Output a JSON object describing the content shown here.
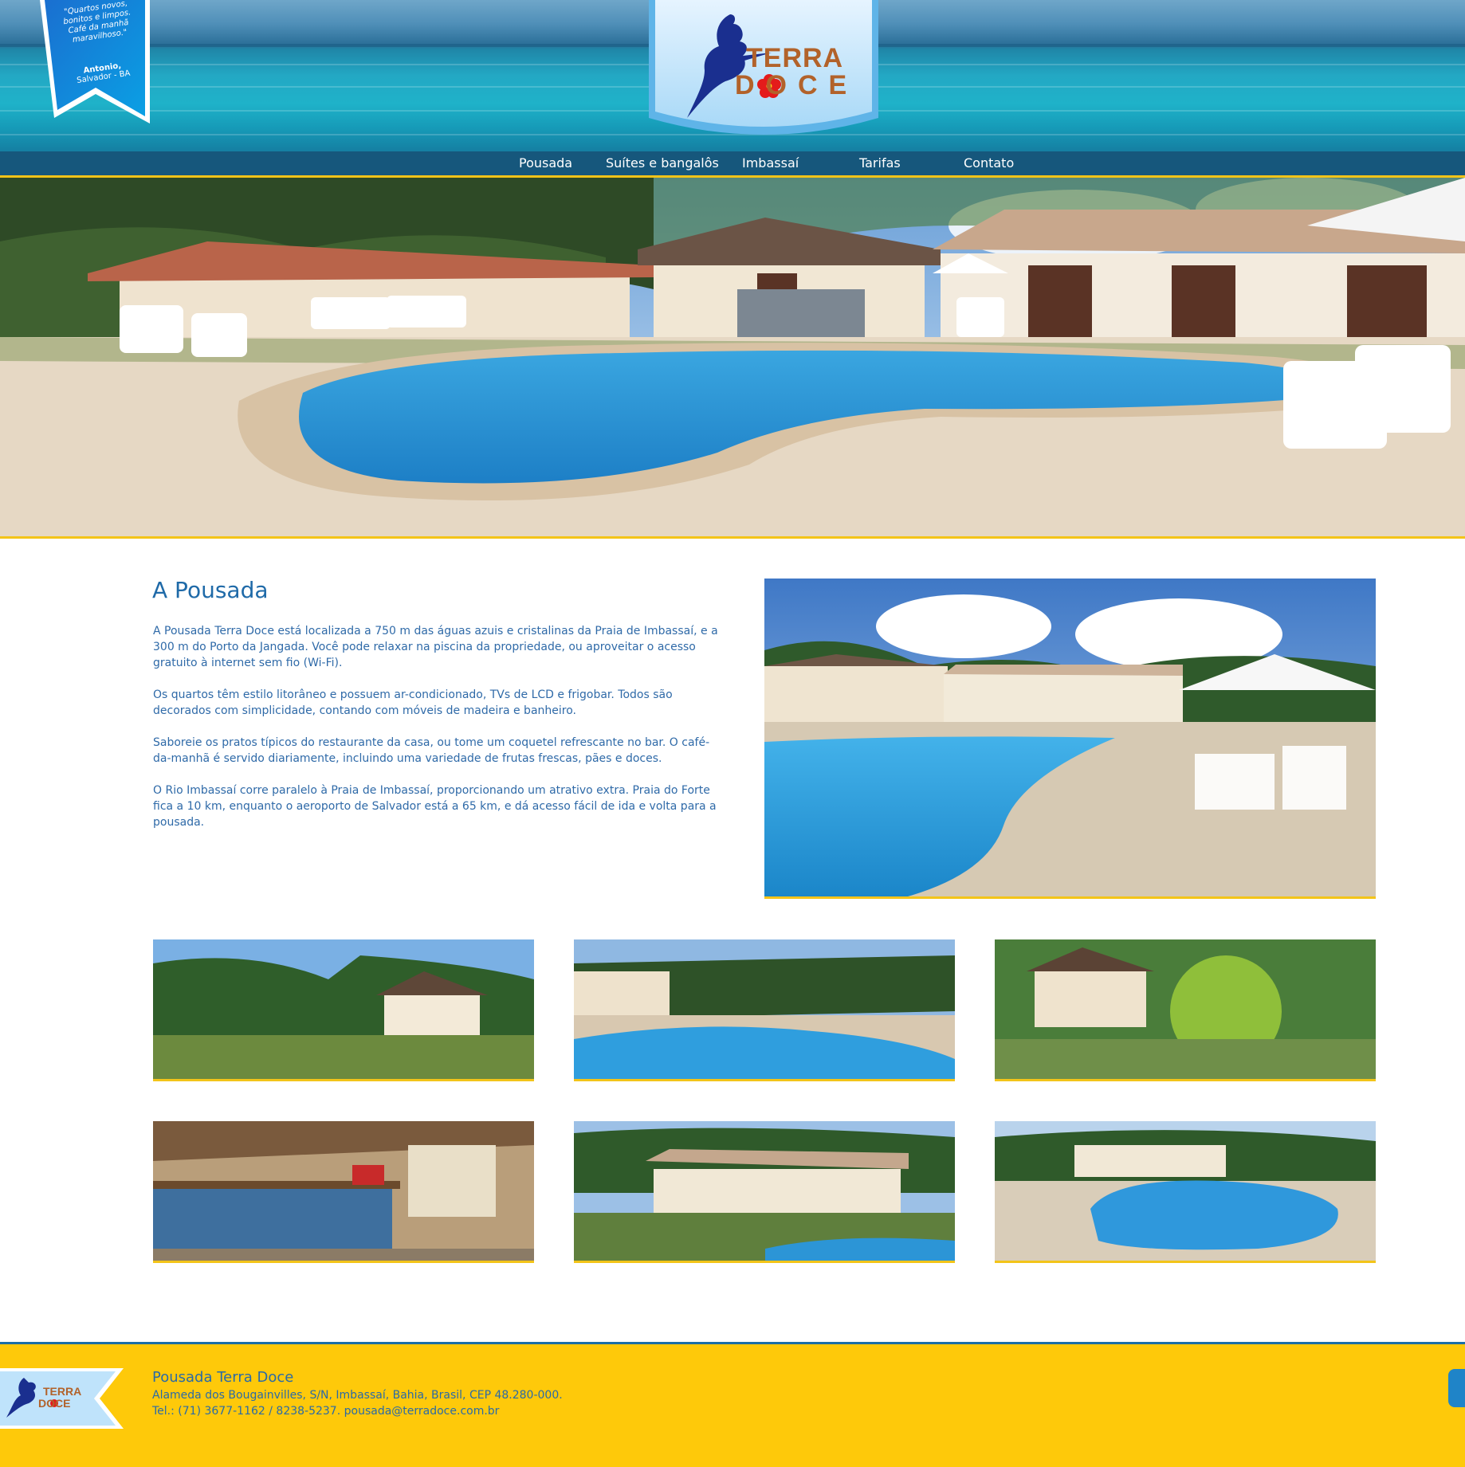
{
  "quote": {
    "text": "\"Quartos novos, bonitos e limpos. Café da manhã maravilhoso.\"",
    "author": "Antonio,",
    "location": "Salvador - BA"
  },
  "logo": {
    "line1": "TERRA",
    "line2": "DOCE"
  },
  "nav": [
    "Pousada",
    "Suítes e bangalôs",
    "Imbassaí",
    "Tarifas",
    "Contato"
  ],
  "content": {
    "title": "A Pousada",
    "paragraphs": [
      "A Pousada Terra Doce está localizada a 750 m das águas azuis e cristalinas da Praia de Imbassaí, e a 300 m do Porto da Jangada. Você pode relaxar na piscina da propriedade, ou aproveitar o acesso gratuito à internet sem fio (Wi-Fi).",
      "Os quartos têm estilo litorâneo e possuem ar-condicionado, TVs de LCD e frigobar. Todos são decorados com simplicidade, contando com móveis de madeira e banheiro.",
      "Saboreie os pratos típicos do restaurante da casa, ou tome um coquetel refrescante no bar. O café-da-manhã é servido diariamente, incluindo uma variedade de frutas frescas, pães e doces.",
      "O Rio Imbassaí corre paralelo à Praia de Imbassaí, proporcionando um atrativo extra. Praia do Forte fica a 10 km, enquanto o aeroporto de Salvador está a 65 km, e dá acesso fácil de ida e volta para a pousada."
    ]
  },
  "footer": {
    "name": "Pousada Terra Doce",
    "address": "Alameda dos Bougainvilles, S/N, Imbassaí, Bahia, Brasil, CEP 48.280-000.",
    "contact": "Tel.: (71) 3677-1162 / 8238-5237. pousada@terradoce.com.br"
  },
  "colors": {
    "nav_bg": "#16577c",
    "accent_yellow": "#f3c419",
    "footer_bg": "#fec90a",
    "text_blue": "#2f6aa8",
    "logo_brown": "#b2622a",
    "logo_navy": "#1a2f8f"
  },
  "icons": [
    "quote-ribbon",
    "hummingbird-logo",
    "red-flower-icon",
    "footer-logo"
  ]
}
